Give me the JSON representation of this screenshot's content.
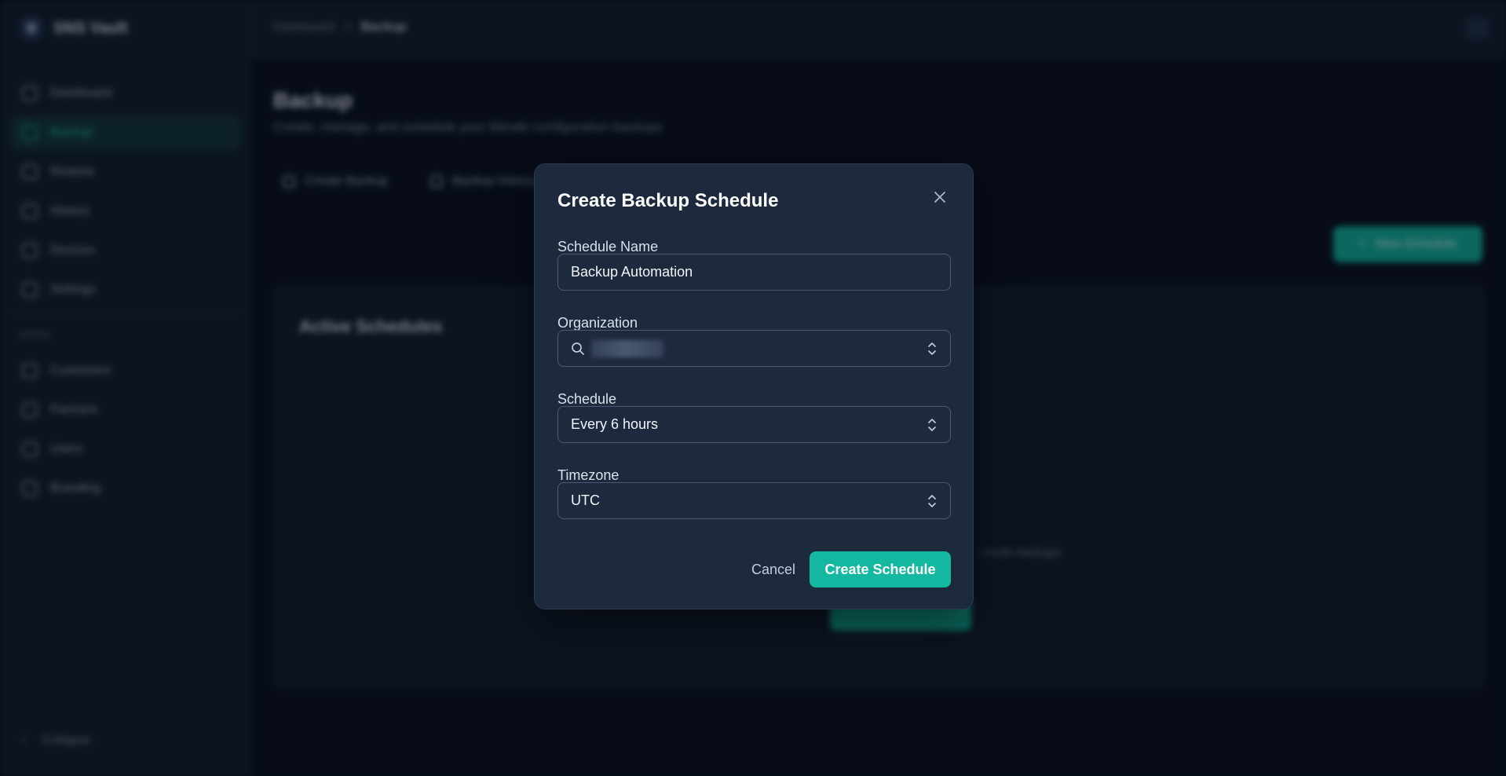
{
  "app": {
    "name": "SNS Vault"
  },
  "breadcrumb": {
    "parent": "Dashboard",
    "separator": ">",
    "current": "Backup"
  },
  "sidebar": {
    "items": [
      {
        "label": "Dashboard",
        "icon": "home-icon"
      },
      {
        "label": "Backup",
        "icon": "backup-icon",
        "active": true
      },
      {
        "label": "Restore",
        "icon": "restore-icon"
      },
      {
        "label": "History",
        "icon": "history-icon"
      },
      {
        "label": "Devices",
        "icon": "devices-icon"
      },
      {
        "label": "Settings",
        "icon": "settings-icon"
      }
    ],
    "section_title": "ADMIN",
    "admin_items": [
      {
        "label": "Customers",
        "icon": "customers-icon"
      },
      {
        "label": "Partners",
        "icon": "partners-icon"
      },
      {
        "label": "Users",
        "icon": "users-icon"
      },
      {
        "label": "Branding",
        "icon": "brush-icon"
      }
    ],
    "collapse_label": "Collapse"
  },
  "page": {
    "title": "Backup",
    "subtitle": "Create, manage, and schedule your Meraki configuration backups",
    "tabs": [
      {
        "label": "Create Backup"
      },
      {
        "label": "Backup History"
      }
    ],
    "new_schedule_label": "New Schedule",
    "panel_title": "Active Schedules",
    "panel_hint": "create backups"
  },
  "modal": {
    "title": "Create Backup Schedule",
    "schedule_name": {
      "label": "Schedule Name",
      "value": "Backup Automation"
    },
    "organization": {
      "label": "Organization"
    },
    "schedule": {
      "label": "Schedule",
      "value": "Every 6 hours"
    },
    "timezone": {
      "label": "Timezone",
      "value": "UTC"
    },
    "cancel_label": "Cancel",
    "submit_label": "Create Schedule"
  },
  "colors": {
    "accent": "#14b8a0",
    "modal_bg": "#1d2a3e",
    "page_bg": "#0b1220"
  }
}
